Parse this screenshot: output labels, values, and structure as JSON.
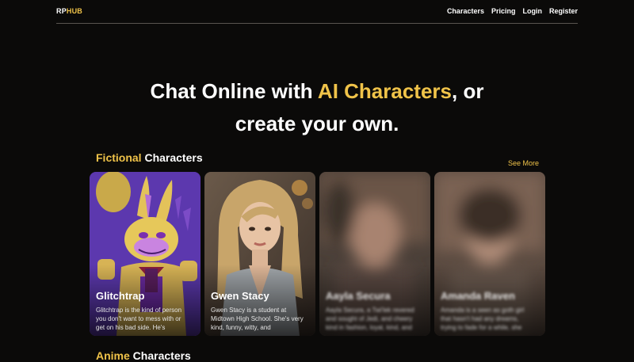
{
  "brand": {
    "part1": "RP",
    "part2": "HUB"
  },
  "nav": {
    "characters": "Characters",
    "pricing": "Pricing",
    "login": "Login",
    "register": "Register"
  },
  "hero": {
    "line1_pre": "Chat Online with ",
    "line1_accent": "AI Characters",
    "line1_post": ", or",
    "line2": "create your own."
  },
  "fictional": {
    "accent": "Fictional",
    "rest": " Characters",
    "see_more": "See More"
  },
  "cards": [
    {
      "name": "Glitchtrap",
      "desc": "Glitchtrap is the kind of person you don't want to mess with or get on his bad side. He's"
    },
    {
      "name": "Gwen Stacy",
      "desc": "Gwen Stacy is a student at Midtown High School. She's very kind, funny, witty, and"
    },
    {
      "name": "Aayla Secura",
      "desc": "Aayla Secura, a Twi'lek revered and sought of Jedi, and cheery kind in fashion, loyal, kind, and"
    },
    {
      "name": "Amanda Raven",
      "desc": "Amanda is a seen as goth girl that hasn't had any dreams, trying to fade for a while, she"
    }
  ],
  "anime": {
    "accent": "Anime",
    "rest": " Characters"
  },
  "colors": {
    "accent": "#f0c349",
    "background": "#0b0a09"
  }
}
